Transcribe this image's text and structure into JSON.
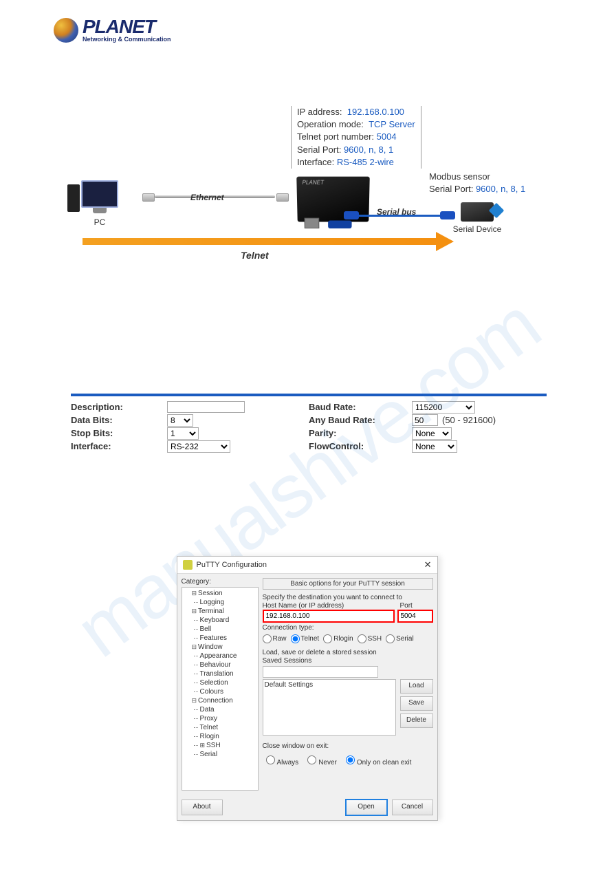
{
  "logo": {
    "name": "PLANET",
    "tagline": "Networking & Communication"
  },
  "device_info": {
    "ip_label": "IP address:",
    "ip": "192.168.0.100",
    "op_label": "Operation mode:",
    "op": "TCP Server",
    "telnet_label": "Telnet port number:",
    "telnet": "5004",
    "serial_label": "Serial Port:",
    "serial": "9600, n, 8, 1",
    "if_label": "Interface:",
    "if": "RS-485 2-wire"
  },
  "sensor": {
    "title": "Modbus sensor",
    "serial_label": "Serial Port:",
    "serial": "9600, n, 8, 1"
  },
  "labels": {
    "pc": "PC",
    "ethernet": "Ethernet",
    "serial_bus": "Serial bus",
    "serial_device": "Serial Device",
    "telnet": "Telnet"
  },
  "form": {
    "description": {
      "label": "Description:",
      "value": ""
    },
    "data_bits": {
      "label": "Data Bits:",
      "value": "8"
    },
    "stop_bits": {
      "label": "Stop Bits:",
      "value": "1"
    },
    "interface": {
      "label": "Interface:",
      "value": "RS-232"
    },
    "baud": {
      "label": "Baud Rate:",
      "value": "115200"
    },
    "any_baud": {
      "label": "Any Baud Rate:",
      "value": "50",
      "range": "(50 - 921600)"
    },
    "parity": {
      "label": "Parity:",
      "value": "None"
    },
    "flow": {
      "label": "FlowControl:",
      "value": "None"
    }
  },
  "putty": {
    "title": "PuTTY Configuration",
    "category": "Category:",
    "tree": {
      "session": "Session",
      "logging": "Logging",
      "terminal": "Terminal",
      "keyboard": "Keyboard",
      "bell": "Bell",
      "features": "Features",
      "window": "Window",
      "appearance": "Appearance",
      "behaviour": "Behaviour",
      "translation": "Translation",
      "selection": "Selection",
      "colours": "Colours",
      "connection": "Connection",
      "data": "Data",
      "proxy": "Proxy",
      "telnet": "Telnet",
      "rlogin": "Rlogin",
      "ssh": "SSH",
      "serial": "Serial"
    },
    "panel_title": "Basic options for your PuTTY session",
    "dest_label": "Specify the destination you want to connect to",
    "host_label": "Host Name (or IP address)",
    "port_label": "Port",
    "host": "192.168.0.100",
    "port": "5004",
    "conn_type": "Connection type:",
    "types": {
      "raw": "Raw",
      "telnet": "Telnet",
      "rlogin": "Rlogin",
      "ssh": "SSH",
      "serial": "Serial"
    },
    "load_label": "Load, save or delete a stored session",
    "saved_label": "Saved Sessions",
    "default_session": "Default Settings",
    "btns": {
      "load": "Load",
      "save": "Save",
      "delete": "Delete"
    },
    "exit_label": "Close window on exit:",
    "exit": {
      "always": "Always",
      "never": "Never",
      "clean": "Only on clean exit"
    },
    "footer": {
      "about": "About",
      "open": "Open",
      "cancel": "Cancel"
    }
  },
  "watermark": "manualshive.com"
}
